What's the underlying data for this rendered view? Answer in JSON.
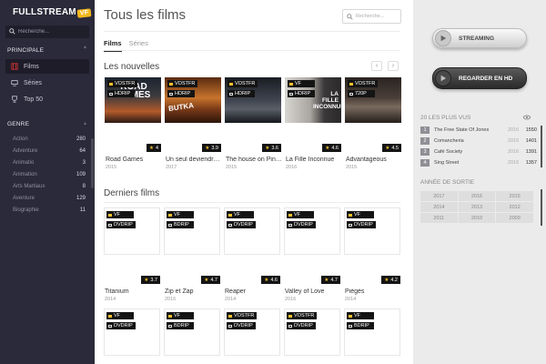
{
  "colors": {
    "sidebar": "#2b2a3a",
    "accent": "#f3b81d",
    "tag_bg": "#141414",
    "star": "#f2c12e"
  },
  "sidebar": {
    "logo": "FULLSTREAM",
    "logo_badge": "VF",
    "search_placeholder": "Recherche...",
    "principale_title": "PRINCIPALE",
    "nav": [
      {
        "label": "Films",
        "icon": "film-icon",
        "active": true
      },
      {
        "label": "Séries",
        "icon": "tv-icon",
        "active": false
      },
      {
        "label": "Top 50",
        "icon": "trophy-icon",
        "active": false
      }
    ],
    "genre_title": "GENRE",
    "genres": [
      {
        "name": "Action",
        "count": "280"
      },
      {
        "name": "Adventure",
        "count": "64"
      },
      {
        "name": "Animatio",
        "count": "3"
      },
      {
        "name": "Animation",
        "count": "109"
      },
      {
        "name": "Arts Martiaux",
        "count": "8"
      },
      {
        "name": "Aventure",
        "count": "129"
      },
      {
        "name": "Biographie",
        "count": "11"
      }
    ]
  },
  "main": {
    "title": "Tous les films",
    "search_placeholder": "Recherche...",
    "tabs": [
      "Films",
      "Séries"
    ],
    "nouvelles_title": "Les nouvelles",
    "derniers_title": "Derniers films",
    "nouvelles": [
      {
        "lang": "VOSTFR",
        "quality": "HDRIP",
        "rating": "4",
        "title": "Road Games",
        "year": "2015",
        "poster_text": "ROAD GAMES"
      },
      {
        "lang": "VOSTFR",
        "quality": "HDRIP",
        "rating": "3.9",
        "title": "Un seul deviendra ...",
        "year": "2017",
        "poster_text": "BUTKA"
      },
      {
        "lang": "VOSTFR",
        "quality": "HDRIP",
        "rating": "3.6",
        "title": "The house on Pine...",
        "year": "2015",
        "poster_text": ""
      },
      {
        "lang": "VF",
        "quality": "HDRIP",
        "rating": "4.6",
        "title": "La Fille Inconnue",
        "year": "2016",
        "poster_text": "LA FILLE INCONNUE"
      },
      {
        "lang": "VOSTFR",
        "quality": "720P",
        "rating": "4.5",
        "title": "Advantageous",
        "year": "2015",
        "poster_text": ""
      }
    ],
    "derniers_row1": [
      {
        "lang": "VF",
        "quality": "DVDRIP",
        "rating": "3.7",
        "title": "Titanium",
        "year": "2014"
      },
      {
        "lang": "VF",
        "quality": "BDRIP",
        "rating": "4.7",
        "title": "Zip et Zap",
        "year": "2016"
      },
      {
        "lang": "VF",
        "quality": "DVDRIP",
        "rating": "4.6",
        "title": "Reaper",
        "year": "2014"
      },
      {
        "lang": "VF",
        "quality": "DVDRIP",
        "rating": "4.7",
        "title": "Valley of Love",
        "year": "2016"
      },
      {
        "lang": "VF",
        "quality": "DVDRIP",
        "rating": "4.2",
        "title": "Piégés",
        "year": "2014"
      }
    ],
    "derniers_row2": [
      {
        "lang": "VF",
        "quality": "DVDRIP"
      },
      {
        "lang": "VF",
        "quality": "BDRIP"
      },
      {
        "lang": "VOSTFR",
        "quality": "DVDRIP"
      },
      {
        "lang": "VOSTFR",
        "quality": "DVDRIP"
      },
      {
        "lang": "VF",
        "quality": "BDRIP"
      }
    ]
  },
  "right": {
    "streaming_label": "STREAMING",
    "hd_label": "REGARDER EN HD",
    "plus_vus_title": "20 LES PLUS VUS",
    "plus_vus": [
      {
        "rank": "1",
        "title": "The Free State Of Jones",
        "year": "2016",
        "views": "1550"
      },
      {
        "rank": "2",
        "title": "Comancheria",
        "year": "2016",
        "views": "1401"
      },
      {
        "rank": "3",
        "title": "Café Society",
        "year": "2016",
        "views": "1391"
      },
      {
        "rank": "4",
        "title": "Sing Street",
        "year": "2016",
        "views": "1357"
      }
    ],
    "annee_title": "ANNÉE DE SORTIE",
    "years": [
      "2017",
      "2016",
      "2015",
      "2014",
      "2013",
      "2012",
      "2011",
      "2010",
      "2009"
    ]
  }
}
